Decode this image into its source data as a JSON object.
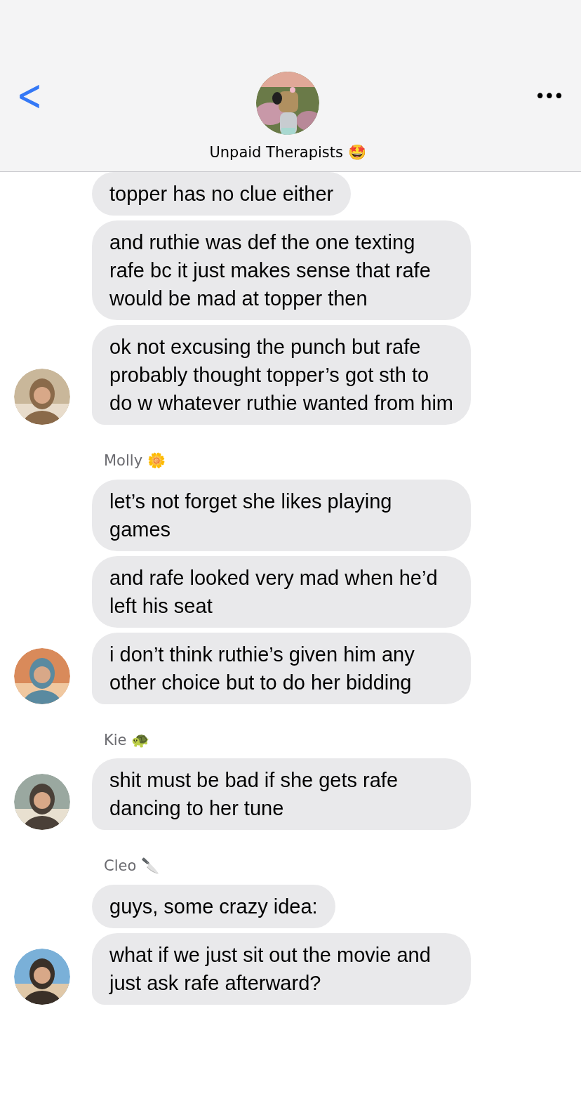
{
  "header": {
    "back": "<",
    "title": "Unpaid Therapists 🤩",
    "more": "•••"
  },
  "groups": [
    {
      "messages": [
        "topper has no clue either",
        "and ruthie was def the one texting rafe bc it just makes sense that rafe would be mad at topper then",
        "ok not excusing the punch but rafe probably thought topper’s got sth to do w whatever ruthie wanted from him"
      ]
    },
    {
      "sender": "Molly 🌼",
      "messages": [
        "let’s not forget she likes playing games",
        "and rafe looked very mad when he’d left his seat",
        "i don’t think ruthie’s given him any other choice but to do her bidding"
      ]
    },
    {
      "sender": "Kie 🐢",
      "messages": [
        "shit must be bad if she gets rafe dancing to her tune"
      ]
    },
    {
      "sender": "Cleo 🔪",
      "messages": [
        "guys, some crazy idea:",
        "what if we just sit out the movie and just ask rafe afterward?"
      ]
    }
  ]
}
